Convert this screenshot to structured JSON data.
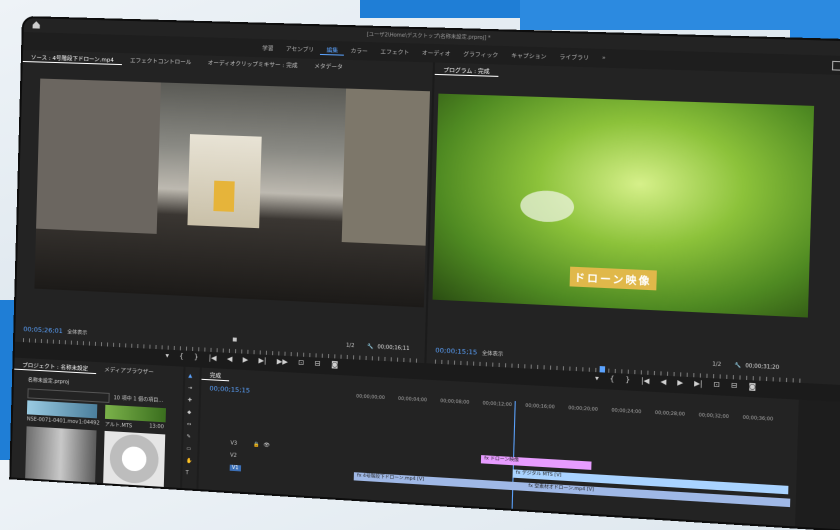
{
  "window": {
    "title": "[ユーザ2\\Home\\デスクトップ\\名称未設定.prproj] *"
  },
  "workspaces": [
    "学習",
    "アセンブリ",
    "編集",
    "カラー",
    "エフェクト",
    "オーディオ",
    "グラフィック",
    "キャプション",
    "ライブラリ"
  ],
  "active_workspace": "編集",
  "more_label": "»",
  "source": {
    "tabs": [
      "ソース : 4号階段下ドローン.mp4",
      "エフェクトコントロール",
      "オーディオクリップミキサー : 完成",
      "メタデータ"
    ],
    "timecode": "00;05;26;01",
    "fit": "全体表示",
    "res": "1/2",
    "duration": "00;00;16;11"
  },
  "program": {
    "tab": "プログラム : 完成",
    "timecode": "00;00;15;15",
    "fit": "全体表示",
    "res": "1/2",
    "duration": "00;00;31;20",
    "caption": "ドローン映像"
  },
  "project": {
    "tabs": [
      "プロジェクト : 名称未設定",
      "メディアブラウザー"
    ],
    "name": "名称未設定.prproj",
    "count": "10 項中 1 個の項目...",
    "items": [
      {
        "name": "NSE-0071-0401.mov",
        "dur": "1:04492"
      },
      {
        "name": "アルト.MTS",
        "dur": "13:00"
      }
    ]
  },
  "timeline": {
    "tab": "完成",
    "timecode": "00;00;15;15",
    "ruler": [
      "00;00;00;00",
      "00;00;04;00",
      "00;00;08;00",
      "00;00;12;00",
      "00;00;16;00",
      "00;00;20;00",
      "00;00;24;00",
      "00;00;28;00",
      "00;00;32;00",
      "00;00;36;00"
    ],
    "tracks": [
      "V3",
      "V2",
      "V1"
    ],
    "clips": [
      {
        "label": "fx ドローン映像",
        "track": "V3",
        "color": "#e79cff"
      },
      {
        "label": "fx デジタル MTS [V]",
        "track": "V2",
        "color": "#a9d3ff"
      },
      {
        "label": "fx 4号階段下ドローン.mp4 [V]",
        "track": "V1",
        "color": "#9fb8e6"
      },
      {
        "label": "fx 空素材オドローン.mp4 [V]",
        "track": "V1",
        "color": "#9fb8e6"
      }
    ]
  },
  "colors": {
    "accent": "#5ba3ff",
    "caption_bg": "#f4c85a"
  },
  "icons": [
    "home-icon",
    "share-icon",
    "play-icon",
    "step-back-icon",
    "step-forward-icon",
    "marker-icon",
    "camera-icon",
    "wrench-icon",
    "selection-tool-icon",
    "razor-tool-icon",
    "hand-tool-icon",
    "type-tool-icon",
    "eye-icon",
    "lock-icon"
  ]
}
